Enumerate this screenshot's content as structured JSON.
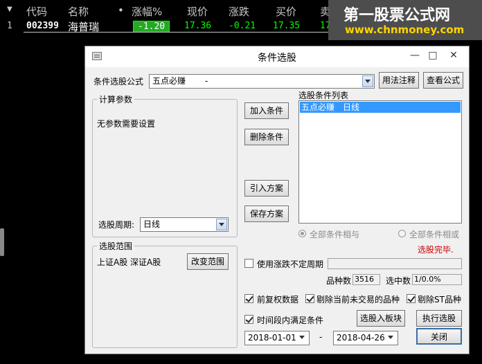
{
  "stock_list": {
    "columns": [
      "代码",
      "名称",
      "•",
      "涨幅%",
      "现价",
      "涨跌",
      "买价",
      "卖"
    ],
    "row": {
      "index": "1",
      "code": "002399",
      "name": "海普瑞",
      "change_pct": "-1.20",
      "price": "17.36",
      "change": "-0.21",
      "bid": "17.35",
      "ask": "17"
    }
  },
  "watermark": {
    "line1": "第一股票公式网",
    "line2": "www.chnmoney.com"
  },
  "dialog": {
    "title": "条件选股",
    "formula_label": "条件选股公式",
    "formula_value": "五点必赚　　 -",
    "usage_button": "用法注释",
    "view_formula_button": "查看公式",
    "calc_params_group": "计算参数",
    "no_params_text": "无参数需要设置",
    "period_label": "选股周期:",
    "period_value": "日线",
    "add_condition_button": "加入条件",
    "delete_condition_button": "删除条件",
    "import_plan_button": "引入方案",
    "save_plan_button": "保存方案",
    "condition_list_label": "选股条件列表",
    "condition_list_items": [
      "五点必赚　日线"
    ],
    "radio_all_and": "全部条件相与",
    "radio_all_or": "全部条件相或",
    "status_text": "选股完毕.",
    "scope_group": "选股范围",
    "scope_text": "上证A股 深证A股",
    "change_scope_button": "改变范围",
    "use_unfixed_period_label": "使用涨跌不定周期",
    "count_label": "品种数",
    "count_value": "3516",
    "selected_label": "选中数",
    "selected_value": "1/0.0%",
    "pre_adjust_label": "前复权数据",
    "exclude_suspended_label": "剔除当前未交易的品种",
    "exclude_st_label": "剔除ST品种",
    "time_range_label": "时间段内满足条件",
    "select_to_block_button": "选股入板块",
    "execute_button": "执行选股",
    "date_from": "2018-01-01",
    "date_sep": "-",
    "date_to": "2018-04-26",
    "close_button": "关闭"
  },
  "colors": {
    "up_green": "#00e000",
    "code_white": "#ffffff",
    "price_green": "#00ff00",
    "status_red": "#cc0000",
    "selection_blue": "#3399ff"
  }
}
